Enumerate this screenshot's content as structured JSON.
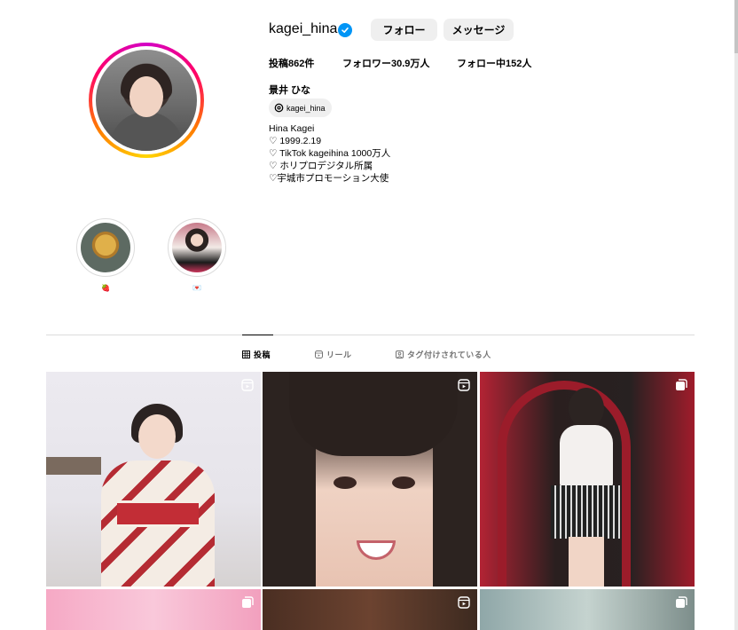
{
  "profile": {
    "username": "kagei_hina",
    "follow_label": "フォロー",
    "message_label": "メッセージ",
    "stats": {
      "posts": "投稿862件",
      "followers": "フォロワー30.9万人",
      "following": "フォロー中152人"
    },
    "full_name": "景井 ひな",
    "threads_handle": "kagei_hina",
    "bio": [
      "Hina Kagei",
      "♡ 1999.2.19",
      "♡ TikTok kageihina 1000万人",
      "♡ ホリプロデジタル所属",
      "♡宇城市プロモーション大使"
    ]
  },
  "highlights": [
    {
      "label": "🍓"
    },
    {
      "label": "💌"
    }
  ],
  "tabs": [
    {
      "label": "投稿",
      "icon": "grid-icon",
      "active": true
    },
    {
      "label": "リール",
      "icon": "reels-icon",
      "active": false
    },
    {
      "label": "タグ付けされている人",
      "icon": "tagged-icon",
      "active": false
    }
  ],
  "posts": [
    {
      "type": "reel"
    },
    {
      "type": "reel"
    },
    {
      "type": "carousel"
    },
    {
      "type": "carousel"
    },
    {
      "type": "reel"
    },
    {
      "type": "carousel"
    }
  ],
  "colors": {
    "verified": "#0095f6",
    "button_bg": "#efefef",
    "divider": "#dbdbdb"
  }
}
